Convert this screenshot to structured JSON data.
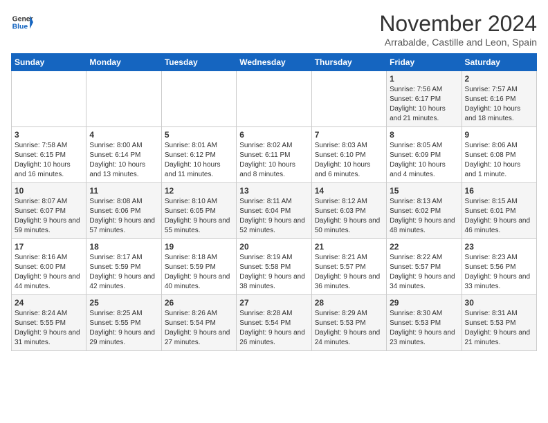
{
  "header": {
    "logo_line1": "General",
    "logo_line2": "Blue",
    "month_title": "November 2024",
    "subtitle": "Arrabalde, Castille and Leon, Spain"
  },
  "weekdays": [
    "Sunday",
    "Monday",
    "Tuesday",
    "Wednesday",
    "Thursday",
    "Friday",
    "Saturday"
  ],
  "weeks": [
    [
      {
        "day": "",
        "info": ""
      },
      {
        "day": "",
        "info": ""
      },
      {
        "day": "",
        "info": ""
      },
      {
        "day": "",
        "info": ""
      },
      {
        "day": "",
        "info": ""
      },
      {
        "day": "1",
        "info": "Sunrise: 7:56 AM\nSunset: 6:17 PM\nDaylight: 10 hours and 21 minutes."
      },
      {
        "day": "2",
        "info": "Sunrise: 7:57 AM\nSunset: 6:16 PM\nDaylight: 10 hours and 18 minutes."
      }
    ],
    [
      {
        "day": "3",
        "info": "Sunrise: 7:58 AM\nSunset: 6:15 PM\nDaylight: 10 hours and 16 minutes."
      },
      {
        "day": "4",
        "info": "Sunrise: 8:00 AM\nSunset: 6:14 PM\nDaylight: 10 hours and 13 minutes."
      },
      {
        "day": "5",
        "info": "Sunrise: 8:01 AM\nSunset: 6:12 PM\nDaylight: 10 hours and 11 minutes."
      },
      {
        "day": "6",
        "info": "Sunrise: 8:02 AM\nSunset: 6:11 PM\nDaylight: 10 hours and 8 minutes."
      },
      {
        "day": "7",
        "info": "Sunrise: 8:03 AM\nSunset: 6:10 PM\nDaylight: 10 hours and 6 minutes."
      },
      {
        "day": "8",
        "info": "Sunrise: 8:05 AM\nSunset: 6:09 PM\nDaylight: 10 hours and 4 minutes."
      },
      {
        "day": "9",
        "info": "Sunrise: 8:06 AM\nSunset: 6:08 PM\nDaylight: 10 hours and 1 minute."
      }
    ],
    [
      {
        "day": "10",
        "info": "Sunrise: 8:07 AM\nSunset: 6:07 PM\nDaylight: 9 hours and 59 minutes."
      },
      {
        "day": "11",
        "info": "Sunrise: 8:08 AM\nSunset: 6:06 PM\nDaylight: 9 hours and 57 minutes."
      },
      {
        "day": "12",
        "info": "Sunrise: 8:10 AM\nSunset: 6:05 PM\nDaylight: 9 hours and 55 minutes."
      },
      {
        "day": "13",
        "info": "Sunrise: 8:11 AM\nSunset: 6:04 PM\nDaylight: 9 hours and 52 minutes."
      },
      {
        "day": "14",
        "info": "Sunrise: 8:12 AM\nSunset: 6:03 PM\nDaylight: 9 hours and 50 minutes."
      },
      {
        "day": "15",
        "info": "Sunrise: 8:13 AM\nSunset: 6:02 PM\nDaylight: 9 hours and 48 minutes."
      },
      {
        "day": "16",
        "info": "Sunrise: 8:15 AM\nSunset: 6:01 PM\nDaylight: 9 hours and 46 minutes."
      }
    ],
    [
      {
        "day": "17",
        "info": "Sunrise: 8:16 AM\nSunset: 6:00 PM\nDaylight: 9 hours and 44 minutes."
      },
      {
        "day": "18",
        "info": "Sunrise: 8:17 AM\nSunset: 5:59 PM\nDaylight: 9 hours and 42 minutes."
      },
      {
        "day": "19",
        "info": "Sunrise: 8:18 AM\nSunset: 5:59 PM\nDaylight: 9 hours and 40 minutes."
      },
      {
        "day": "20",
        "info": "Sunrise: 8:19 AM\nSunset: 5:58 PM\nDaylight: 9 hours and 38 minutes."
      },
      {
        "day": "21",
        "info": "Sunrise: 8:21 AM\nSunset: 5:57 PM\nDaylight: 9 hours and 36 minutes."
      },
      {
        "day": "22",
        "info": "Sunrise: 8:22 AM\nSunset: 5:57 PM\nDaylight: 9 hours and 34 minutes."
      },
      {
        "day": "23",
        "info": "Sunrise: 8:23 AM\nSunset: 5:56 PM\nDaylight: 9 hours and 33 minutes."
      }
    ],
    [
      {
        "day": "24",
        "info": "Sunrise: 8:24 AM\nSunset: 5:55 PM\nDaylight: 9 hours and 31 minutes."
      },
      {
        "day": "25",
        "info": "Sunrise: 8:25 AM\nSunset: 5:55 PM\nDaylight: 9 hours and 29 minutes."
      },
      {
        "day": "26",
        "info": "Sunrise: 8:26 AM\nSunset: 5:54 PM\nDaylight: 9 hours and 27 minutes."
      },
      {
        "day": "27",
        "info": "Sunrise: 8:28 AM\nSunset: 5:54 PM\nDaylight: 9 hours and 26 minutes."
      },
      {
        "day": "28",
        "info": "Sunrise: 8:29 AM\nSunset: 5:53 PM\nDaylight: 9 hours and 24 minutes."
      },
      {
        "day": "29",
        "info": "Sunrise: 8:30 AM\nSunset: 5:53 PM\nDaylight: 9 hours and 23 minutes."
      },
      {
        "day": "30",
        "info": "Sunrise: 8:31 AM\nSunset: 5:53 PM\nDaylight: 9 hours and 21 minutes."
      }
    ]
  ]
}
